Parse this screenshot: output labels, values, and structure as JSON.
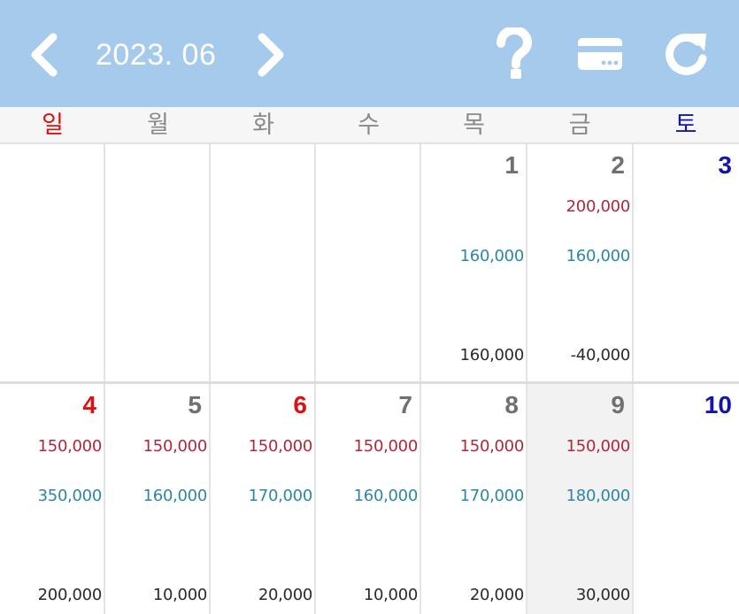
{
  "header": {
    "month": "2023. 06",
    "prev_icon": "chevron-left-icon",
    "next_icon": "chevron-right-icon",
    "help_icon": "question-mark-icon",
    "card_icon": "credit-card-icon",
    "refresh_icon": "refresh-icon",
    "background_color": "#a6caeb"
  },
  "weekdays": [
    "일",
    "월",
    "화",
    "수",
    "목",
    "금",
    "토"
  ],
  "colors": {
    "sunday": "#dd1111",
    "saturday": "#1515aa",
    "expense": "#b0283c",
    "income": "#2c86a8",
    "balance": "#2a2a2a"
  },
  "weeks": [
    [
      {
        "day": "",
        "expense": "",
        "income": "",
        "balance": ""
      },
      {
        "day": "",
        "expense": "",
        "income": "",
        "balance": ""
      },
      {
        "day": "",
        "expense": "",
        "income": "",
        "balance": ""
      },
      {
        "day": "",
        "expense": "",
        "income": "",
        "balance": ""
      },
      {
        "day": "1",
        "expense": "",
        "income": "160,000",
        "balance": "160,000"
      },
      {
        "day": "2",
        "expense": "200,000",
        "income": "160,000",
        "balance": "-40,000"
      },
      {
        "day": "3",
        "expense": "",
        "income": "",
        "balance": ""
      }
    ],
    [
      {
        "day": "4",
        "expense": "150,000",
        "income": "350,000",
        "balance": "200,000"
      },
      {
        "day": "5",
        "expense": "150,000",
        "income": "160,000",
        "balance": "10,000"
      },
      {
        "day": "6",
        "expense": "150,000",
        "income": "170,000",
        "balance": "20,000"
      },
      {
        "day": "7",
        "expense": "150,000",
        "income": "160,000",
        "balance": "10,000"
      },
      {
        "day": "8",
        "expense": "150,000",
        "income": "170,000",
        "balance": "20,000"
      },
      {
        "day": "9",
        "expense": "150,000",
        "income": "180,000",
        "balance": "30,000",
        "today": true
      },
      {
        "day": "10",
        "expense": "",
        "income": "",
        "balance": ""
      }
    ]
  ],
  "holidays": [
    "6"
  ]
}
